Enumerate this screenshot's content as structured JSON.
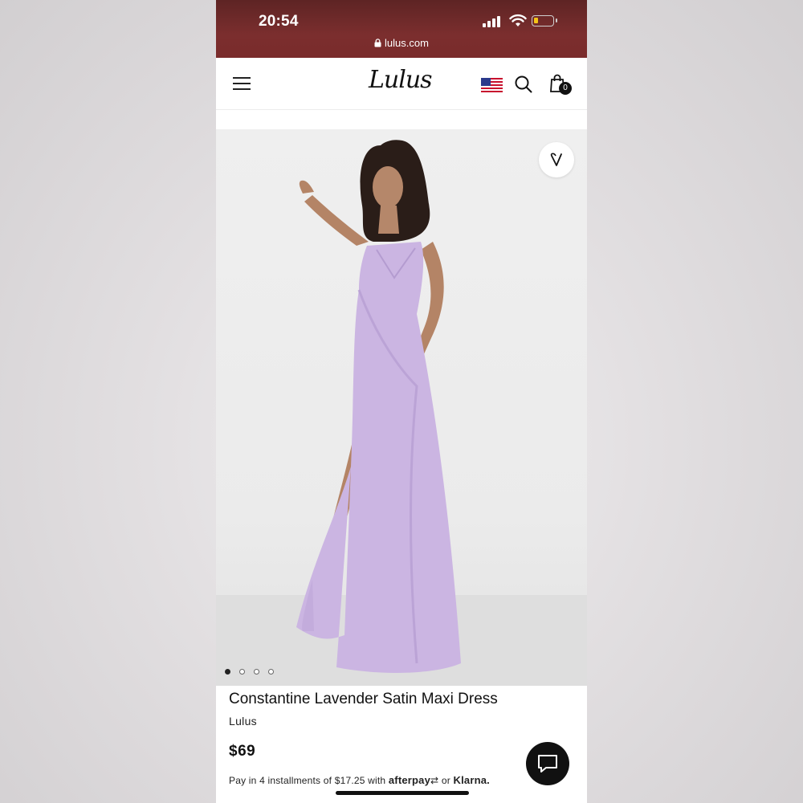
{
  "status_bar": {
    "time": "20:54",
    "url": "lulus.com"
  },
  "header": {
    "logo": "Lulus",
    "cart_count": "0"
  },
  "carousel": {
    "dots": 4,
    "active_index": 0
  },
  "product": {
    "title": "Constantine Lavender Satin Maxi Dress",
    "brand": "Lulus",
    "price": "$69",
    "installments_text": "Pay in 4 installments of $17.25 with",
    "afterpay": "afterpay",
    "or": "or",
    "klarna": "Klarna."
  },
  "colors": {
    "status_bar": "#7a2b2b",
    "dress": "#c9b3e0",
    "accent": "#111111"
  }
}
